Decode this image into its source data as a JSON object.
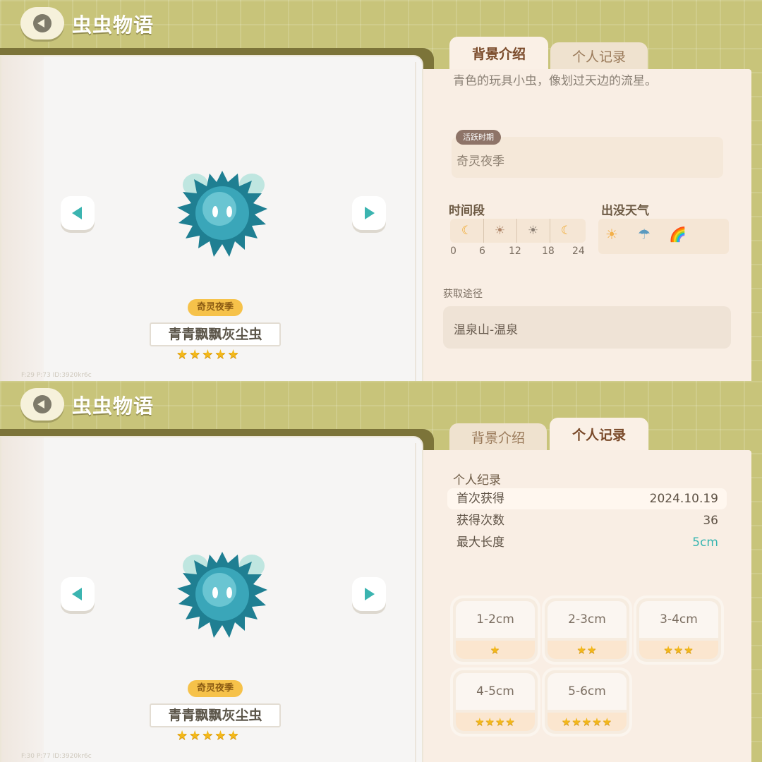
{
  "header": {
    "title": "虫虫物语"
  },
  "bug": {
    "season_badge": "奇灵夜季",
    "name": "青青飘飘灰尘虫",
    "stars": "★★★★★",
    "bug_color": "#3aa6b9"
  },
  "tabs": {
    "intro": "背景介绍",
    "record": "个人记录"
  },
  "panel1": {
    "debug": "F:29    P:73    ID:3920kr6c",
    "intro_text": "青色的玩具小虫，像划过天边的流星。",
    "active_period_tag": "活跃时期",
    "active_period": "奇灵夜季",
    "time_label": "时间段",
    "weather_label": "出没天气",
    "time_icons": [
      "☾",
      "☀",
      "☀",
      "☾"
    ],
    "time_ticks": [
      "0",
      "6",
      "12",
      "18",
      "24"
    ],
    "weather_icons": [
      "☀",
      "☂",
      "🌈"
    ],
    "obtain_label": "获取途径",
    "obtain_value": "温泉山-温泉"
  },
  "panel2": {
    "debug": "F:30    P:77    ID:3920kr6c",
    "record_title": "个人纪录",
    "rows": [
      {
        "key": "首次获得",
        "value": "2024.10.19"
      },
      {
        "key": "获得次数",
        "value": "36"
      },
      {
        "key": "最大长度",
        "value": "5cm"
      }
    ],
    "size_cards": [
      {
        "range": "1-2cm",
        "stars": "★"
      },
      {
        "range": "2-3cm",
        "stars": "★★"
      },
      {
        "range": "3-4cm",
        "stars": "★★★"
      },
      {
        "range": "4-5cm",
        "stars": "★★★★"
      },
      {
        "range": "5-6cm",
        "stars": "★★★★★"
      }
    ]
  }
}
